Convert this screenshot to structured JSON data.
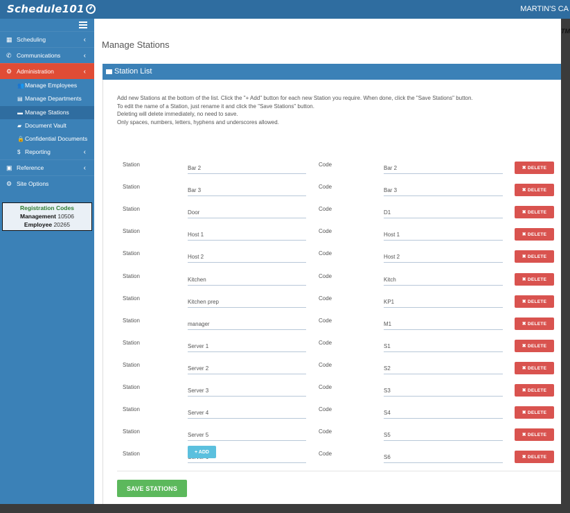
{
  "header": {
    "logo_text": "Schedule101",
    "user_name": "MARTIN'S CA",
    "edge_fragment": "TM"
  },
  "sidebar": {
    "items": [
      {
        "label": "Scheduling",
        "icon": "calendar-icon"
      },
      {
        "label": "Communications",
        "icon": "phone-icon"
      },
      {
        "label": "Administration",
        "icon": "cogs-icon",
        "active": true
      }
    ],
    "admin_sub": [
      {
        "label": "Manage Employees",
        "icon": "users-icon"
      },
      {
        "label": "Manage Departments",
        "icon": "list-icon"
      },
      {
        "label": "Manage Stations",
        "icon": "table-icon",
        "current": true
      },
      {
        "label": "Document Vault",
        "icon": "folder-icon"
      },
      {
        "label": "Confidential Documents",
        "icon": "lock-icon"
      },
      {
        "label": "Reporting",
        "icon": "dollar-icon"
      }
    ],
    "items_after": [
      {
        "label": "Reference",
        "icon": "book-icon"
      },
      {
        "label": "Site Options",
        "icon": "cogs-icon"
      }
    ],
    "registration": {
      "title": "Registration Codes",
      "management_label": "Management",
      "management_code": "10506",
      "employee_label": "Employee",
      "employee_code": "20265"
    }
  },
  "main": {
    "page_title": "Manage Stations",
    "panel_title": "Station List",
    "instructions": [
      "Add new Stations at the bottom of the list. Click the \"+ Add\" button for each new Station you require. When done, click the \"Save Stations\" button.",
      "To edit the name of a Station, just rename it and click the \"Save Stations\" button.",
      "Deleting will delete immediately, no need to save.",
      "Only spaces, numbers, letters, hyphens and underscores allowed."
    ],
    "station_label": "Station",
    "code_label": "Code",
    "delete_label": "DELETE",
    "stations": [
      {
        "station": "Bar 2",
        "code": "Bar 2"
      },
      {
        "station": "Bar 3",
        "code": "Bar 3"
      },
      {
        "station": "Door",
        "code": "D1"
      },
      {
        "station": "Host 1",
        "code": "Host 1"
      },
      {
        "station": "Host 2",
        "code": "Host 2"
      },
      {
        "station": "Kitchen",
        "code": "Kitch"
      },
      {
        "station": "Kitchen prep",
        "code": "KP1"
      },
      {
        "station": "manager",
        "code": "M1"
      },
      {
        "station": "Server 1",
        "code": "S1"
      },
      {
        "station": "Server 2",
        "code": "S2"
      },
      {
        "station": "Server 3",
        "code": "S3"
      },
      {
        "station": "Server 4",
        "code": "S4"
      },
      {
        "station": "Server 5",
        "code": "S5"
      },
      {
        "station": "Server 6",
        "code": "S6"
      }
    ],
    "add_label": "ADD",
    "save_label": "SAVE STATIONS"
  },
  "colors": {
    "brand_blue": "#2f6da0",
    "sidebar_blue": "#3b81b7",
    "active_red": "#e04c35",
    "delete_red": "#d9534f",
    "add_cyan": "#5bc0de",
    "save_green": "#5cb85c"
  }
}
